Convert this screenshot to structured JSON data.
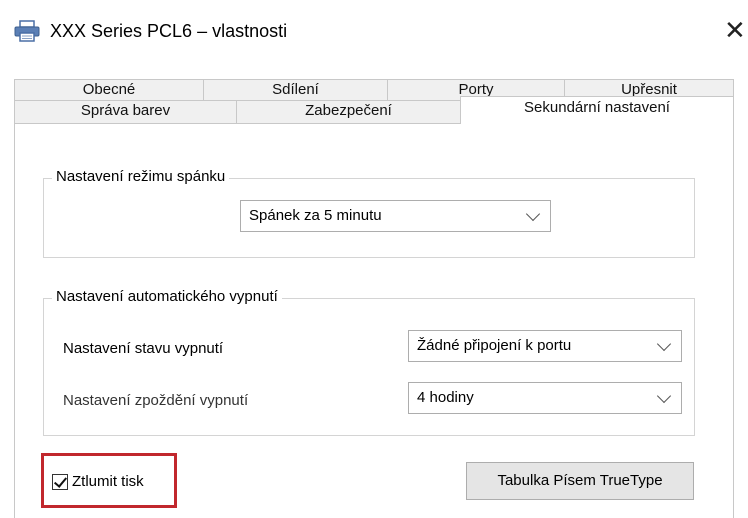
{
  "window": {
    "title": "XXX Series PCL6 – vlastnosti",
    "close_glyph": "✕"
  },
  "tabs": {
    "row1": [
      "Obecné",
      "Sdílení",
      "Porty",
      "Upřesnit"
    ],
    "row2": [
      "Správa barev",
      "Zabezpečení",
      "Sekundární nastavení"
    ],
    "active": "Sekundární nastavení"
  },
  "sleep_group": {
    "legend": "Nastavení režimu spánku",
    "selected": "Spánek za 5 minutu"
  },
  "auto_off_group": {
    "legend": "Nastavení automatického vypnutí",
    "state_label": "Nastavení stavu vypnutí",
    "state_value": "Žádné připojení k portu",
    "delay_label": "Nastavení zpoždění vypnutí",
    "delay_value": "4 hodiny"
  },
  "footer": {
    "mute_label": "Ztlumit tisk",
    "mute_checked": true,
    "truetype_button": "Tabulka Písem TrueType"
  },
  "colors": {
    "highlight": "#c1272d",
    "tab_inactive": "#f0f0f0"
  }
}
